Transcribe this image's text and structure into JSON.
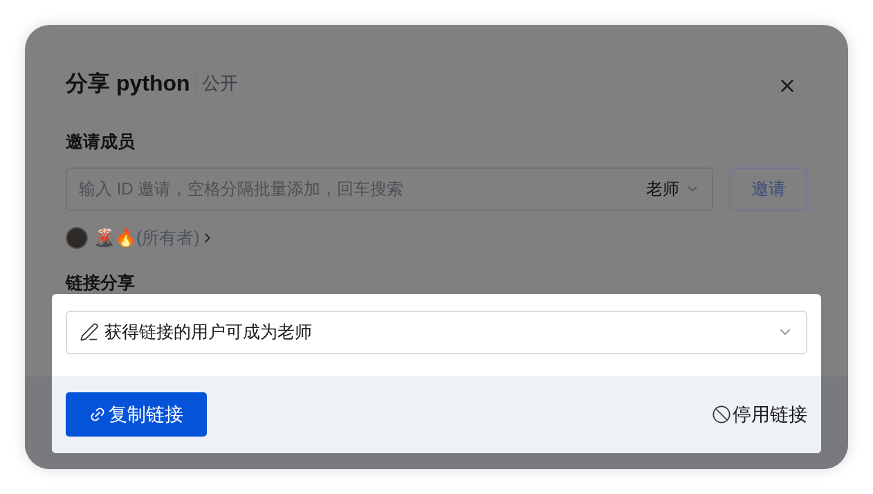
{
  "dialog": {
    "title": "分享 python",
    "visibility": "公开"
  },
  "invite": {
    "label": "邀请成员",
    "placeholder": "输入 ID 邀请，空格分隔批量添加，回车搜索",
    "role": "老师",
    "button": {
      "label": "邀请",
      "disabled": true
    }
  },
  "owner": {
    "name": "🌋🔥(所有者)"
  },
  "link_share": {
    "label": "链接分享",
    "permission": "获得链接的用户可成为老师",
    "copy_button": "复制链接",
    "disable_button": "停用链接"
  }
}
